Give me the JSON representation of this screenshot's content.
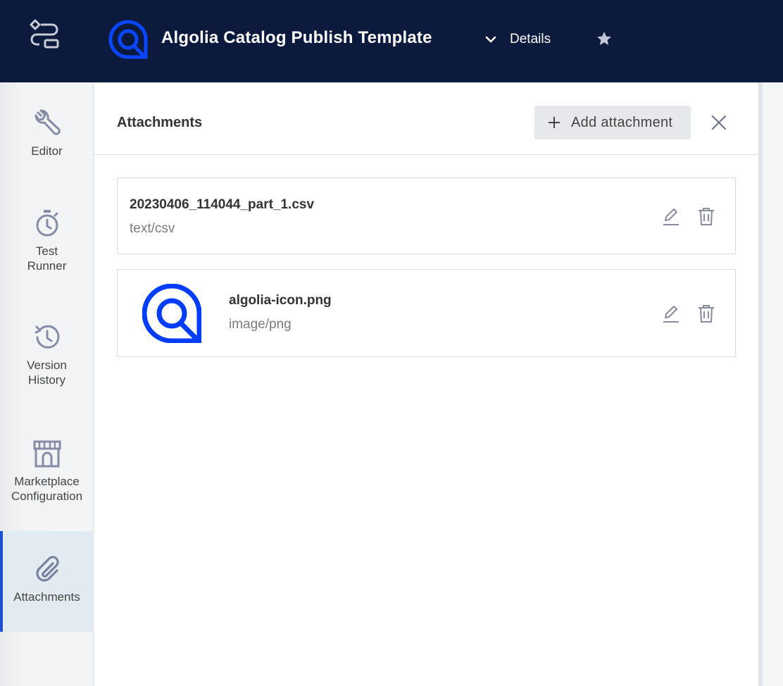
{
  "header": {
    "title": "Algolia Catalog Publish Template",
    "details_label": "Details"
  },
  "sidebar": {
    "items": [
      {
        "label": "Editor",
        "icon": "wrench-icon"
      },
      {
        "label": "Test Runner",
        "icon": "stopwatch-icon"
      },
      {
        "label": "Version History",
        "icon": "history-icon"
      },
      {
        "label": "Marketplace Configuration",
        "icon": "storefront-icon"
      },
      {
        "label": "Attachments",
        "icon": "paperclip-icon",
        "active": true
      }
    ]
  },
  "panel": {
    "title": "Attachments",
    "add_button_label": "Add attachment"
  },
  "attachments": [
    {
      "name": "20230406_114044_part_1.csv",
      "type": "text/csv"
    },
    {
      "name": "algolia-icon.png",
      "type": "image/png",
      "thumbnail": "algolia-logo"
    }
  ],
  "colors": {
    "header_bg": "#0c1a3e",
    "accent": "#1a4fd6",
    "brand_blue": "#003dff"
  }
}
